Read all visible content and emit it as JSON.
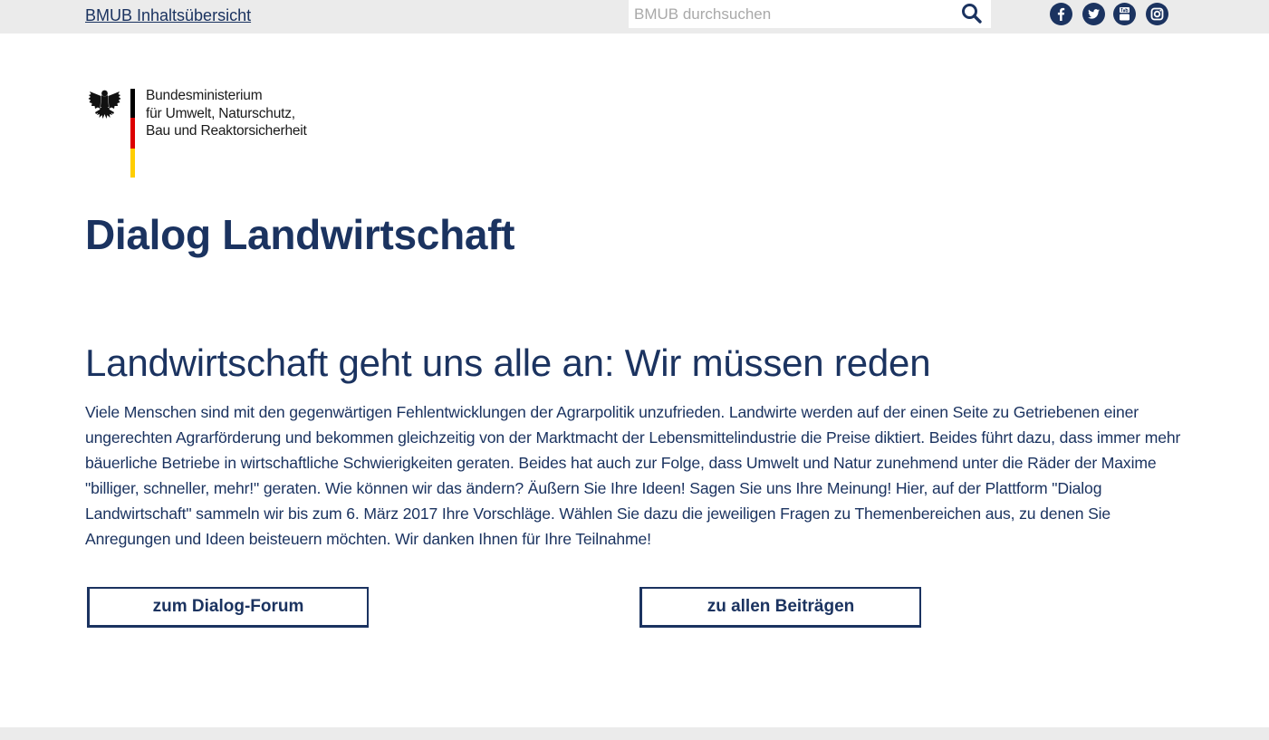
{
  "topbar": {
    "toc_link": "BMUB Inhaltsübersicht",
    "search_placeholder": "BMUB durchsuchen",
    "social": [
      "facebook",
      "twitter",
      "youtube",
      "instagram"
    ]
  },
  "logo": {
    "line1": "Bundesministerium",
    "line2": "für Umwelt, Naturschutz,",
    "line3": "Bau und Reaktorsicherheit"
  },
  "site_title": "Dialog Landwirtschaft",
  "headline": "Landwirtschaft geht uns alle an: Wir müssen reden",
  "intro": "Viele Menschen sind mit den gegenwärtigen Fehlentwicklungen der Agrarpolitik unzufrieden. Landwirte werden auf der einen Seite zu Getriebenen einer ungerechten Agrarförderung und bekommen gleichzeitig von der Marktmacht der Lebensmittelindustrie die Preise diktiert. Beides führt dazu, dass immer mehr bäuerliche Betriebe in wirtschaftliche Schwierigkeiten geraten. Beides hat auch zur Folge, dass Umwelt und Natur zunehmend unter die Räder der Maxime \"billiger, schneller, mehr!\" geraten. Wie können wir das ändern? Äußern Sie Ihre Ideen! Sagen Sie uns Ihre Meinung! Hier, auf der Plattform \"Dialog Landwirtschaft\" sammeln wir bis zum 6. März 2017 Ihre Vorschläge. Wählen Sie dazu die jeweiligen Fragen zu Themenbereichen aus, zu denen Sie Anregungen und Ideen beisteuern möchten. Wir danken Ihnen für Ihre Teilnahme!",
  "buttons": {
    "forum": "zum Dialog-Forum",
    "all_posts": "zu allen Beiträgen"
  },
  "colors": {
    "brand_navy": "#1b3360",
    "topbar_bg": "#ebebeb",
    "flag_black": "#000000",
    "flag_red": "#dd0000",
    "flag_gold": "#ffce00"
  }
}
